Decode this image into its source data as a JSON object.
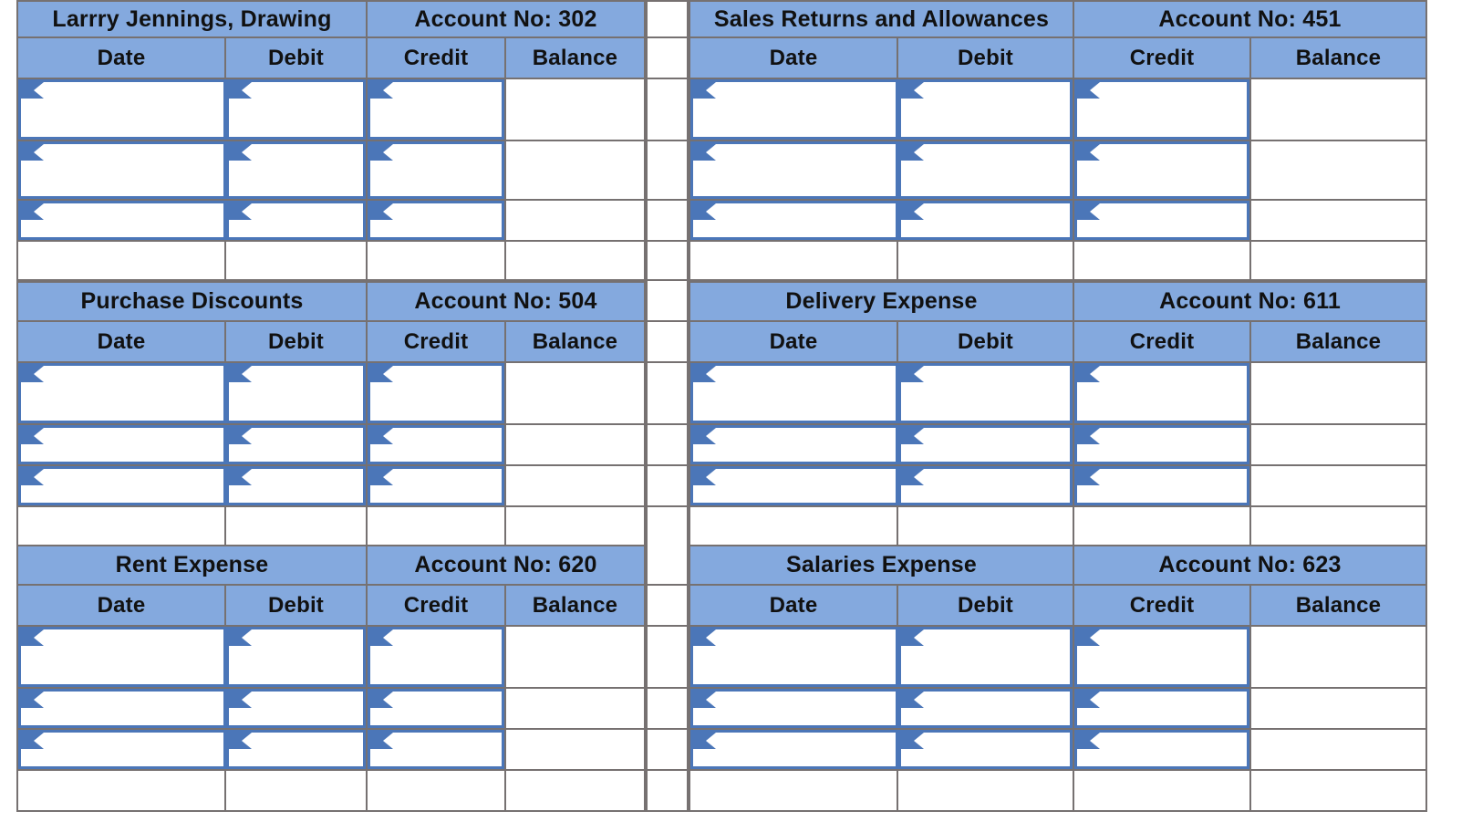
{
  "document": {
    "type": "general-ledger-worksheet",
    "column_headers": [
      "Date",
      "Debit",
      "Credit",
      "Balance"
    ],
    "account_label_prefix": "Account No:"
  },
  "colors": {
    "header_blue": "#84A9DE",
    "input_border_blue": "#4B76B8",
    "gridline_gray": "#767171",
    "text_black": "#111111",
    "cell_white": "#FFFFFF"
  },
  "ledgers": [
    {
      "id": "larrry-jennings-drawing",
      "position": "row1-left",
      "title": "Larrry Jennings, Drawing",
      "account_no": "Account No: 302",
      "headers": [
        "Date",
        "Debit",
        "Credit",
        "Balance"
      ],
      "rows": [
        {
          "date": "",
          "debit": "",
          "credit": "",
          "balance": ""
        },
        {
          "date": "",
          "debit": "",
          "credit": "",
          "balance": ""
        },
        {
          "date": "",
          "debit": "",
          "credit": "",
          "balance": ""
        }
      ]
    },
    {
      "id": "sales-returns-and-allowances",
      "position": "row1-right",
      "title": "Sales Returns and Allowances",
      "account_no": "Account No: 451",
      "headers": [
        "Date",
        "Debit",
        "Credit",
        "Balance"
      ],
      "rows": [
        {
          "date": "",
          "debit": "",
          "credit": "",
          "balance": ""
        },
        {
          "date": "",
          "debit": "",
          "credit": "",
          "balance": ""
        },
        {
          "date": "",
          "debit": "",
          "credit": "",
          "balance": ""
        }
      ]
    },
    {
      "id": "purchase-discounts",
      "position": "row2-left",
      "title": "Purchase Discounts",
      "account_no": "Account No: 504",
      "headers": [
        "Date",
        "Debit",
        "Credit",
        "Balance"
      ],
      "rows": [
        {
          "date": "",
          "debit": "",
          "credit": "",
          "balance": ""
        },
        {
          "date": "",
          "debit": "",
          "credit": "",
          "balance": ""
        },
        {
          "date": "",
          "debit": "",
          "credit": "",
          "balance": ""
        }
      ]
    },
    {
      "id": "delivery-expense",
      "position": "row2-right",
      "title": "Delivery Expense",
      "account_no": "Account No: 611",
      "headers": [
        "Date",
        "Debit",
        "Credit",
        "Balance"
      ],
      "rows": [
        {
          "date": "",
          "debit": "",
          "credit": "",
          "balance": ""
        },
        {
          "date": "",
          "debit": "",
          "credit": "",
          "balance": ""
        },
        {
          "date": "",
          "debit": "",
          "credit": "",
          "balance": ""
        }
      ]
    },
    {
      "id": "rent-expense",
      "position": "row3-left",
      "title": "Rent Expense",
      "account_no": "Account No: 620",
      "headers": [
        "Date",
        "Debit",
        "Credit",
        "Balance"
      ],
      "rows": [
        {
          "date": "",
          "debit": "",
          "credit": "",
          "balance": ""
        },
        {
          "date": "",
          "debit": "",
          "credit": "",
          "balance": ""
        },
        {
          "date": "",
          "debit": "",
          "credit": "",
          "balance": ""
        }
      ]
    },
    {
      "id": "salaries-expense",
      "position": "row3-right",
      "title": "Salaries Expense",
      "account_no": "Account No: 623",
      "headers": [
        "Date",
        "Debit",
        "Credit",
        "Balance"
      ],
      "rows": [
        {
          "date": "",
          "debit": "",
          "credit": "",
          "balance": ""
        },
        {
          "date": "",
          "debit": "",
          "credit": "",
          "balance": ""
        },
        {
          "date": "",
          "debit": "",
          "credit": "",
          "balance": ""
        }
      ]
    }
  ]
}
